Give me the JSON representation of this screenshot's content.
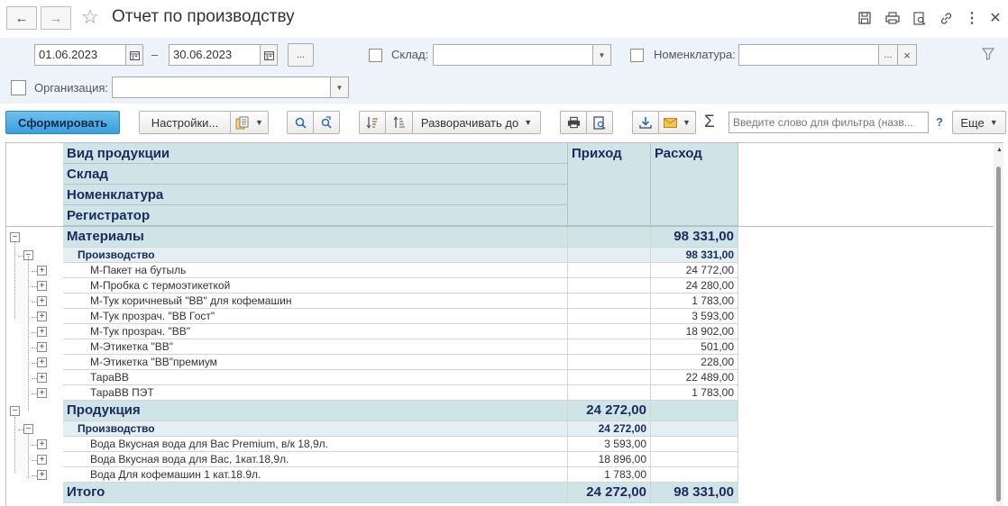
{
  "window": {
    "title": "Отчет по производству"
  },
  "nav": {
    "back": "←",
    "forward": "→",
    "star": "☆"
  },
  "top_icons": [
    {
      "name": "save-icon",
      "glyph": "🖫"
    },
    {
      "name": "print-icon",
      "glyph": "🖶"
    },
    {
      "name": "preview-icon",
      "glyph": "🔍"
    },
    {
      "name": "link-icon",
      "glyph": "🔗"
    },
    {
      "name": "more-icon",
      "glyph": "⋮"
    },
    {
      "name": "close-icon",
      "glyph": "✕"
    }
  ],
  "filters": {
    "date_from": "01.06.2023",
    "date_sep": "–",
    "date_to": "30.06.2023",
    "period_btn": "...",
    "warehouse_label": "Склад:",
    "warehouse_value": "",
    "nomenclature_label": "Номенклатура:",
    "nomenclature_value": "",
    "nomenclature_dots": "...",
    "nomenclature_clear": "×",
    "organization_label": "Организация:",
    "organization_value": ""
  },
  "toolbar": {
    "generate": "Сформировать",
    "settings": "Настройки...",
    "expand_to": "Разворачивать до",
    "filter_placeholder": "Введите слово для фильтра (назв...",
    "help": "?",
    "more": "Еще",
    "sigma": "Σ"
  },
  "table": {
    "headers": {
      "groupings": [
        "Вид продукции",
        "Склад",
        "Номенклатура",
        "Регистратор"
      ],
      "income": "Приход",
      "expense": "Расход"
    },
    "rows": [
      {
        "level": 1,
        "name": "Материалы",
        "income": "",
        "expense": "98 331,00"
      },
      {
        "level": 2,
        "name": "Производство",
        "income": "",
        "expense": "98 331,00"
      },
      {
        "level": 3,
        "name": "М-Пакет на бутыль",
        "income": "",
        "expense": "24 772,00"
      },
      {
        "level": 3,
        "name": "М-Пробка с термоэтикеткой",
        "income": "",
        "expense": "24 280,00"
      },
      {
        "level": 3,
        "name": "М-Тук коричневый \"ВВ\" для кофемашин",
        "income": "",
        "expense": "1 783,00"
      },
      {
        "level": 3,
        "name": "М-Тук прозрач. \"ВВ Гост\"",
        "income": "",
        "expense": "3 593,00"
      },
      {
        "level": 3,
        "name": "М-Тук прозрач. \"ВВ\"",
        "income": "",
        "expense": "18 902,00"
      },
      {
        "level": 3,
        "name": "М-Этикетка \"ВВ\"",
        "income": "",
        "expense": "501,00"
      },
      {
        "level": 3,
        "name": "М-Этикетка \"ВВ\"премиум",
        "income": "",
        "expense": "228,00"
      },
      {
        "level": 3,
        "name": "ТараВВ",
        "income": "",
        "expense": "22 489,00"
      },
      {
        "level": 3,
        "name": "ТараВВ ПЭТ",
        "income": "",
        "expense": "1 783,00"
      },
      {
        "level": 1,
        "name": "Продукция",
        "income": "24 272,00",
        "expense": ""
      },
      {
        "level": 2,
        "name": "Производство",
        "income": "24 272,00",
        "expense": ""
      },
      {
        "level": 3,
        "name": "Вода Вкусная вода для Вас Premium, в/к 18,9л.",
        "income": "3 593,00",
        "expense": ""
      },
      {
        "level": 3,
        "name": "Вода Вкусная вода для Вас, 1кат.18,9л.",
        "income": "18 896,00",
        "expense": ""
      },
      {
        "level": 3,
        "name": "Вода Для кофемашин 1 кат.18.9л.",
        "income": "1 783,00",
        "expense": ""
      },
      {
        "level": 0,
        "name": "Итого",
        "income": "24 272,00",
        "expense": "98 331,00"
      }
    ]
  }
}
